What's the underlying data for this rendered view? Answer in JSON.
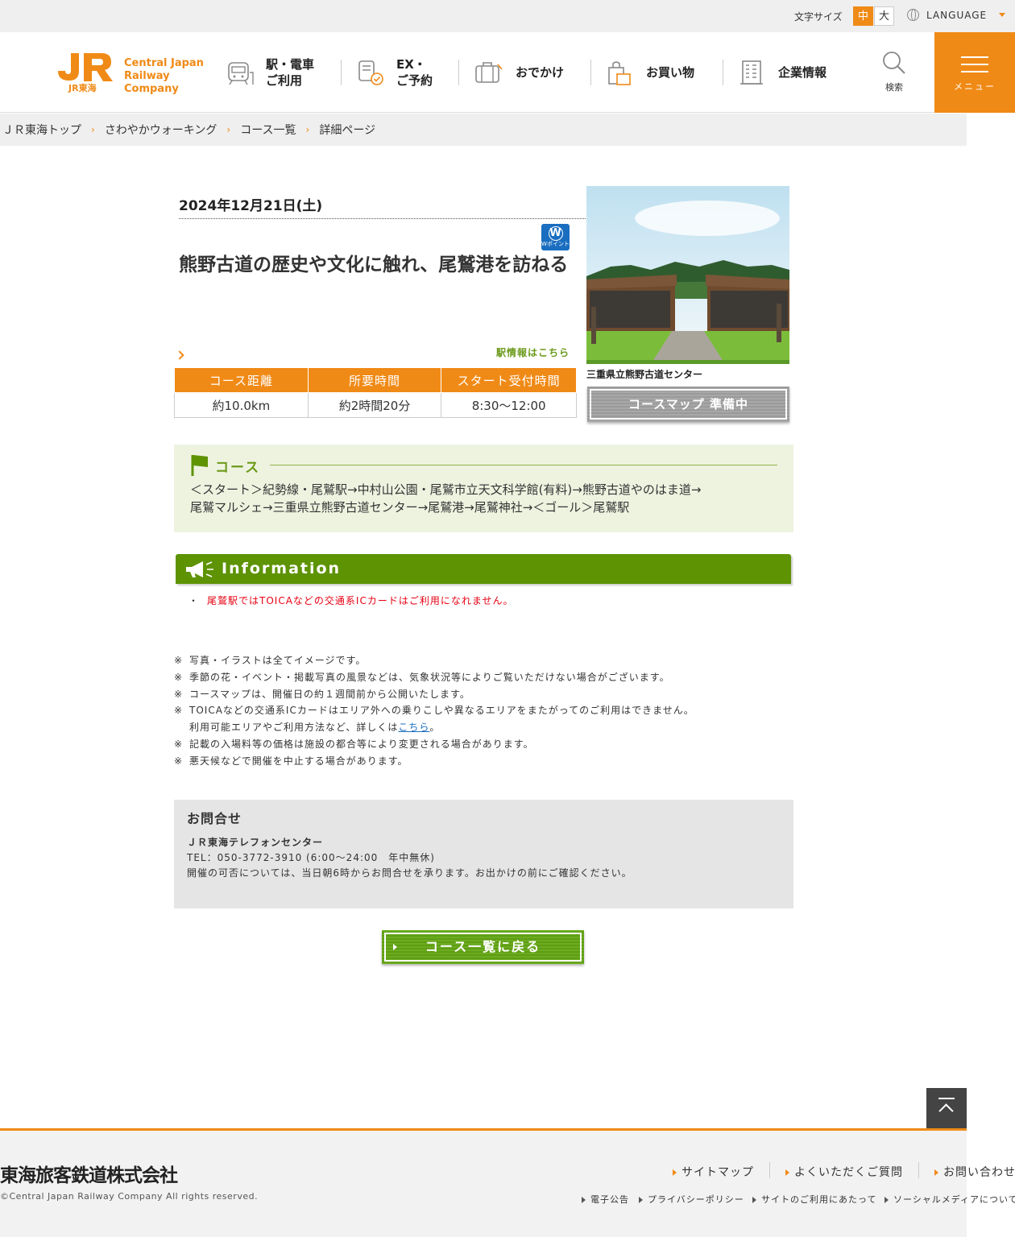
{
  "utility": {
    "font_size_label": "文字サイズ",
    "font_size_mid": "中",
    "font_size_large": "大",
    "language": "LANGUAGE"
  },
  "header": {
    "logo_line1": "Central Japan",
    "logo_line2": "Railway Company",
    "logo_sub": "JR東海",
    "nav": [
      {
        "label": "駅・電車\nご利用"
      },
      {
        "label": "EX・\nご予約"
      },
      {
        "label": "おでかけ"
      },
      {
        "label": "お買い物"
      },
      {
        "label": "企業情報"
      }
    ],
    "search_label": "検索",
    "menu_label": "メニュー"
  },
  "breadcrumb": [
    "ＪＲ東海トップ",
    "さわやかウォーキング",
    "コース一覧",
    "詳細ページ"
  ],
  "event": {
    "date": "2024年12月21日(土)",
    "wpoint_label": "Wポイント",
    "title": "熊野古道の歴史や文化に触れ、尾鷲港を訪ねる",
    "station_link": "駅情報はこちら",
    "table_headers": [
      "コース距離",
      "所要時間",
      "スタート受付時間"
    ],
    "table_values": [
      "約10.0km",
      "約2時間20分",
      "8:30～12:00"
    ],
    "photo_caption": "三重県立熊野古道センター",
    "map_button": "コースマップ 準備中"
  },
  "course": {
    "heading": "コース",
    "route_line1": "＜スタート＞紀勢線・尾鷲駅→中村山公園・尾鷲市立天文科学館(有料)→熊野古道やのはま道→",
    "route_line2": "尾鷲マルシェ→三重県立熊野古道センター→尾鷲港→尾鷲神社→＜ゴール＞尾鷲駅"
  },
  "information": {
    "title": "Information",
    "items": [
      "尾鷲駅ではTOICAなどの交通系ICカードはご利用になれません。"
    ]
  },
  "notes": {
    "mark": "※",
    "n1": "写真・イラストは全てイメージです。",
    "n2": "季節の花・イベント・掲載写真の風景などは、気象状況等によりご覧いただけない場合がございます。",
    "n3": "コースマップは、開催日の約１週間前から公開いたします。",
    "n4": "TOICAなどの交通系ICカードはエリア外への乗りこしや異なるエリアをまたがってのご利用はできません。",
    "n4b_prefix": "利用可能エリアやご利用方法など、詳しくは",
    "n4b_link": "こちら",
    "n4b_suffix": "。",
    "n5": "記載の入場料等の価格は施設の都合等により変更される場合があります。",
    "n6": "悪天候などで開催を中止する場合があります。"
  },
  "contact": {
    "title": "お問合せ",
    "name": "ＪＲ東海テレフォンセンター",
    "tel": "TEL：050-3772-3910 (6:00～24:00　年中無休)",
    "note": "開催の可否については、当日朝6時からお問合せを承ります。お出かけの前にご確認ください。"
  },
  "back_button": "コース一覧に戻る",
  "footer": {
    "company": "東海旅客鉄道株式会社",
    "copyright": "©Central Japan Railway Company All rights reserved.",
    "links": [
      "サイトマップ",
      "よくいただくご質問",
      "お問い合わせ"
    ],
    "small_links": [
      "電子公告",
      "プライバシーポリシー",
      "サイトのご利用にあたって",
      "ソーシャルメディアについて"
    ]
  },
  "colors": {
    "accent": "#f08a16",
    "green": "#5e9304",
    "alert": "#e60012"
  }
}
